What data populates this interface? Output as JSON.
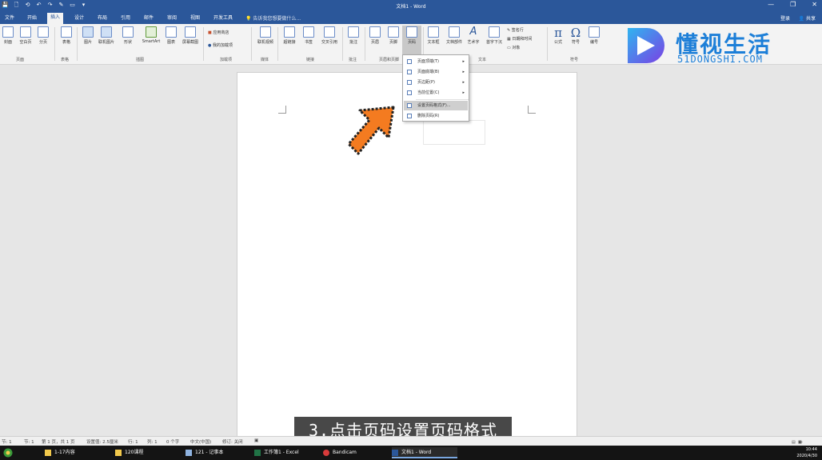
{
  "window": {
    "title": "文档1 - Word",
    "controls": [
      "—",
      "❐",
      "✕"
    ]
  },
  "quick_access": [
    "💾",
    "🗋",
    "⟲",
    "↶",
    "↷",
    "✎",
    "▭",
    "▾"
  ],
  "tabs": [
    {
      "label": "文件"
    },
    {
      "label": "开始"
    },
    {
      "label": "插入",
      "active": true
    },
    {
      "label": "设计"
    },
    {
      "label": "布局"
    },
    {
      "label": "引用"
    },
    {
      "label": "邮件"
    },
    {
      "label": "审阅"
    },
    {
      "label": "视图"
    },
    {
      "label": "开发工具"
    }
  ],
  "tell_me": "告诉我您想要做什么...",
  "login": "登录",
  "share": "共享",
  "ribbon": {
    "buttons": [
      {
        "label": "封面"
      },
      {
        "label": "空白页"
      },
      {
        "label": "分页"
      },
      {
        "label": "表格"
      },
      {
        "label": "图片"
      },
      {
        "label": "联机图片"
      },
      {
        "label": "形状"
      },
      {
        "label": "SmartArt"
      },
      {
        "label": "图表"
      },
      {
        "label": "屏幕截图"
      },
      {
        "label": "联机视频"
      },
      {
        "label": "超链接"
      },
      {
        "label": "书签"
      },
      {
        "label": "交叉引用"
      },
      {
        "label": "批注"
      },
      {
        "label": "页眉"
      },
      {
        "label": "页脚"
      },
      {
        "label": "页码"
      },
      {
        "label": "文本框"
      },
      {
        "label": "文档部件"
      },
      {
        "label": "艺术字"
      },
      {
        "label": "首字下沉"
      },
      {
        "label": "公式"
      },
      {
        "label": "符号"
      },
      {
        "label": "编号"
      }
    ],
    "small_items": [
      "应用商店",
      "我的加载项",
      "签名行",
      "日期和时间",
      "对象"
    ],
    "groups": [
      "页面",
      "表格",
      "插图",
      "加载项",
      "媒体",
      "链接",
      "批注",
      "页眉和页脚",
      "文本",
      "符号"
    ]
  },
  "page_number_menu": [
    {
      "label": "页面顶端(T)",
      "has_arrow": true
    },
    {
      "label": "页面底端(B)",
      "has_arrow": true
    },
    {
      "label": "页边距(P)",
      "has_arrow": true
    },
    {
      "label": "当前位置(C)",
      "has_arrow": true
    },
    {
      "label": "设置页码格式(F)...",
      "highlighted": true
    },
    {
      "label": "删除页码(R)"
    }
  ],
  "logo": {
    "text": "懂视生活",
    "sub": "51DONGSHI.COM"
  },
  "caption": "3.点击页码设置页码格式",
  "status_bar": {
    "items": [
      "节: 1",
      "节: 1",
      "第 1 页，共 1 页",
      "设置值: 2.5厘米",
      "行: 1",
      "列: 1",
      "0 个字",
      "中文(中国)",
      "修订: 关闭",
      "▣"
    ]
  },
  "taskbar": {
    "apps": [
      {
        "label": "1-17内容"
      },
      {
        "label": "120课程"
      },
      {
        "label": "121 - 记事本"
      },
      {
        "label": "工作簿1 - Excel"
      },
      {
        "label": "Bandicam"
      },
      {
        "label": "文档1 - Word",
        "active": true
      }
    ],
    "time": "10:44",
    "date": "2020/4/30"
  },
  "colors": {
    "accent": "#2b579a",
    "logo": "#1d7fd8",
    "arrow": "#f47b20"
  }
}
